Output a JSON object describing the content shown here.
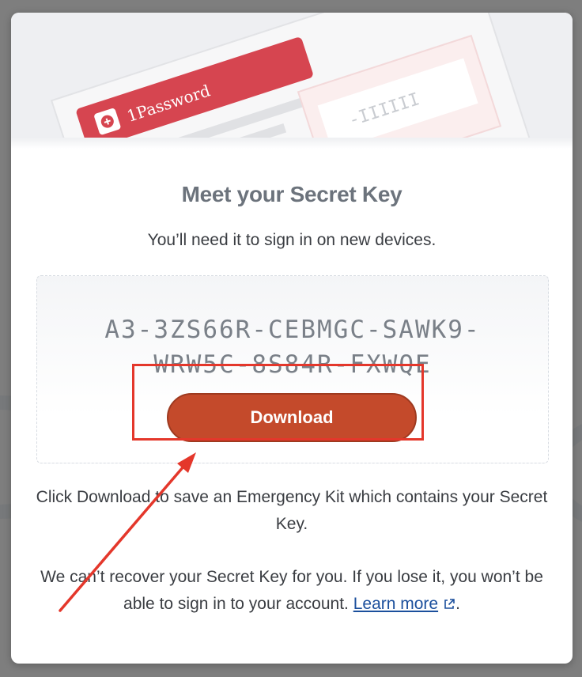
{
  "hero": {
    "card_brand": "1Password",
    "key_fragment": "-IIIIII"
  },
  "dialog": {
    "title": "Meet your Secret Key",
    "subtitle": "You’ll need it to sign in on new devices."
  },
  "secret_key": {
    "line1": "A3-3ZS66R-CEBMGC-SAWK9-",
    "line2": "WRW5C-8S84R-FXWQE"
  },
  "download_button": {
    "label": "Download"
  },
  "info": {
    "download_text": "Click Download to save an Emergency Kit which contains your Secret Key.",
    "recover_text": "We can’t recover your Secret Key for you. If you lose it, you won’t be able to sign in to your account.",
    "learn_more": "Learn more",
    "period": "."
  },
  "colors": {
    "accent": "#c44a2b",
    "annotation": "#e4372b",
    "link": "#1b4f9c"
  }
}
